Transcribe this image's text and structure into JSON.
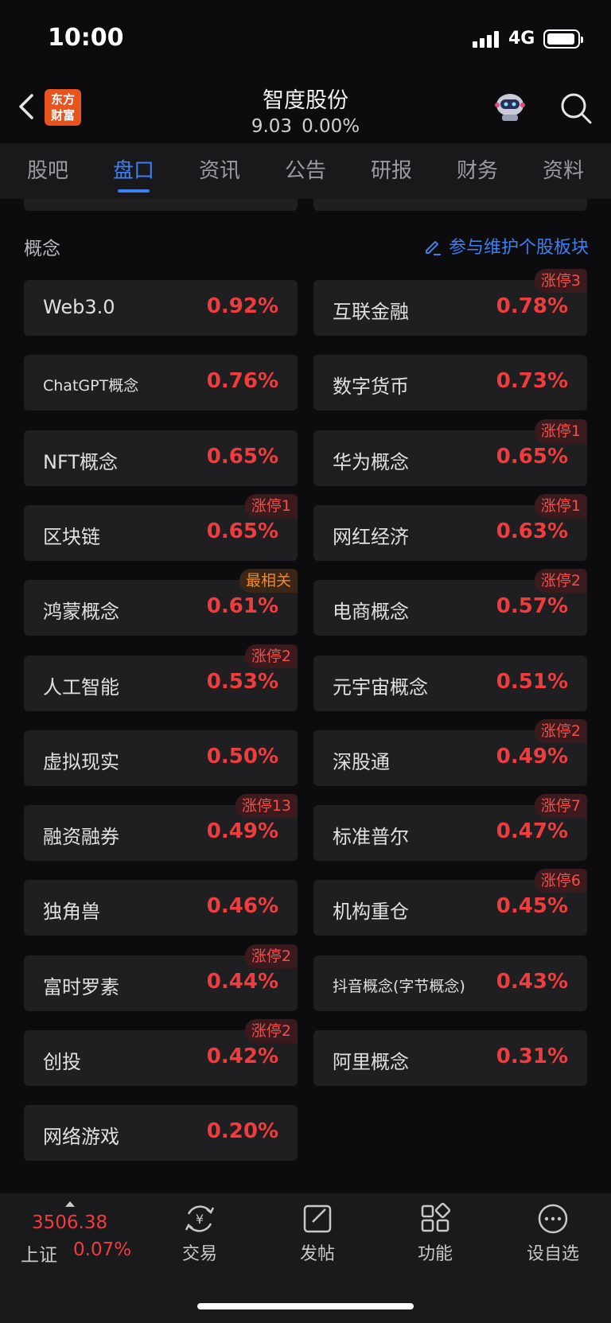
{
  "status": {
    "time": "10:00",
    "network": "4G"
  },
  "header": {
    "logo_line1": "东方",
    "logo_line2": "财富",
    "title": "智度股份",
    "price": "9.03",
    "change": "0.00%"
  },
  "tabs": [
    {
      "label": "股吧"
    },
    {
      "label": "盘口"
    },
    {
      "label": "资讯"
    },
    {
      "label": "公告"
    },
    {
      "label": "研报"
    },
    {
      "label": "财务"
    },
    {
      "label": "资料"
    }
  ],
  "active_tab": "盘口",
  "section": {
    "title": "概念",
    "action": "参与维护个股板块"
  },
  "concepts": [
    {
      "name": "Web3.0",
      "pct": "0.92%",
      "badge": ""
    },
    {
      "name": "互联金融",
      "pct": "0.78%",
      "badge": "涨停3"
    },
    {
      "name": "ChatGPT概念",
      "pct": "0.76%",
      "badge": ""
    },
    {
      "name": "数字货币",
      "pct": "0.73%",
      "badge": ""
    },
    {
      "name": "NFT概念",
      "pct": "0.65%",
      "badge": ""
    },
    {
      "name": "华为概念",
      "pct": "0.65%",
      "badge": "涨停1"
    },
    {
      "name": "区块链",
      "pct": "0.65%",
      "badge": "涨停1"
    },
    {
      "name": "网红经济",
      "pct": "0.63%",
      "badge": "涨停1"
    },
    {
      "name": "鸿蒙概念",
      "pct": "0.61%",
      "badge": "最相关"
    },
    {
      "name": "电商概念",
      "pct": "0.57%",
      "badge": "涨停2"
    },
    {
      "name": "人工智能",
      "pct": "0.53%",
      "badge": "涨停2"
    },
    {
      "name": "元宇宙概念",
      "pct": "0.51%",
      "badge": ""
    },
    {
      "name": "虚拟现实",
      "pct": "0.50%",
      "badge": ""
    },
    {
      "name": "深股通",
      "pct": "0.49%",
      "badge": "涨停2"
    },
    {
      "name": "融资融券",
      "pct": "0.49%",
      "badge": "涨停13"
    },
    {
      "name": "标准普尔",
      "pct": "0.47%",
      "badge": "涨停7"
    },
    {
      "name": "独角兽",
      "pct": "0.46%",
      "badge": ""
    },
    {
      "name": "机构重仓",
      "pct": "0.45%",
      "badge": "涨停6"
    },
    {
      "name": "富时罗素",
      "pct": "0.44%",
      "badge": "涨停2"
    },
    {
      "name": "抖音概念(字节概念)",
      "pct": "0.43%",
      "badge": ""
    },
    {
      "name": "创投",
      "pct": "0.42%",
      "badge": "涨停2"
    },
    {
      "name": "阿里概念",
      "pct": "0.31%",
      "badge": ""
    },
    {
      "name": "网络游戏",
      "pct": "0.20%",
      "badge": ""
    }
  ],
  "bottom": {
    "index_value": "3506.38",
    "index_name": "上证",
    "index_pct": "0.07%",
    "nav": [
      {
        "label": "交易",
        "icon": "trade-yen-icon"
      },
      {
        "label": "发帖",
        "icon": "post-edit-icon"
      },
      {
        "label": "功能",
        "icon": "functions-grid-icon"
      },
      {
        "label": "设自选",
        "icon": "more-dots-icon"
      }
    ]
  },
  "colors": {
    "accent": "#3d7ef0",
    "up": "#f03c3c",
    "badge_orange": "#f08a2a",
    "logo": "#e8541e"
  }
}
